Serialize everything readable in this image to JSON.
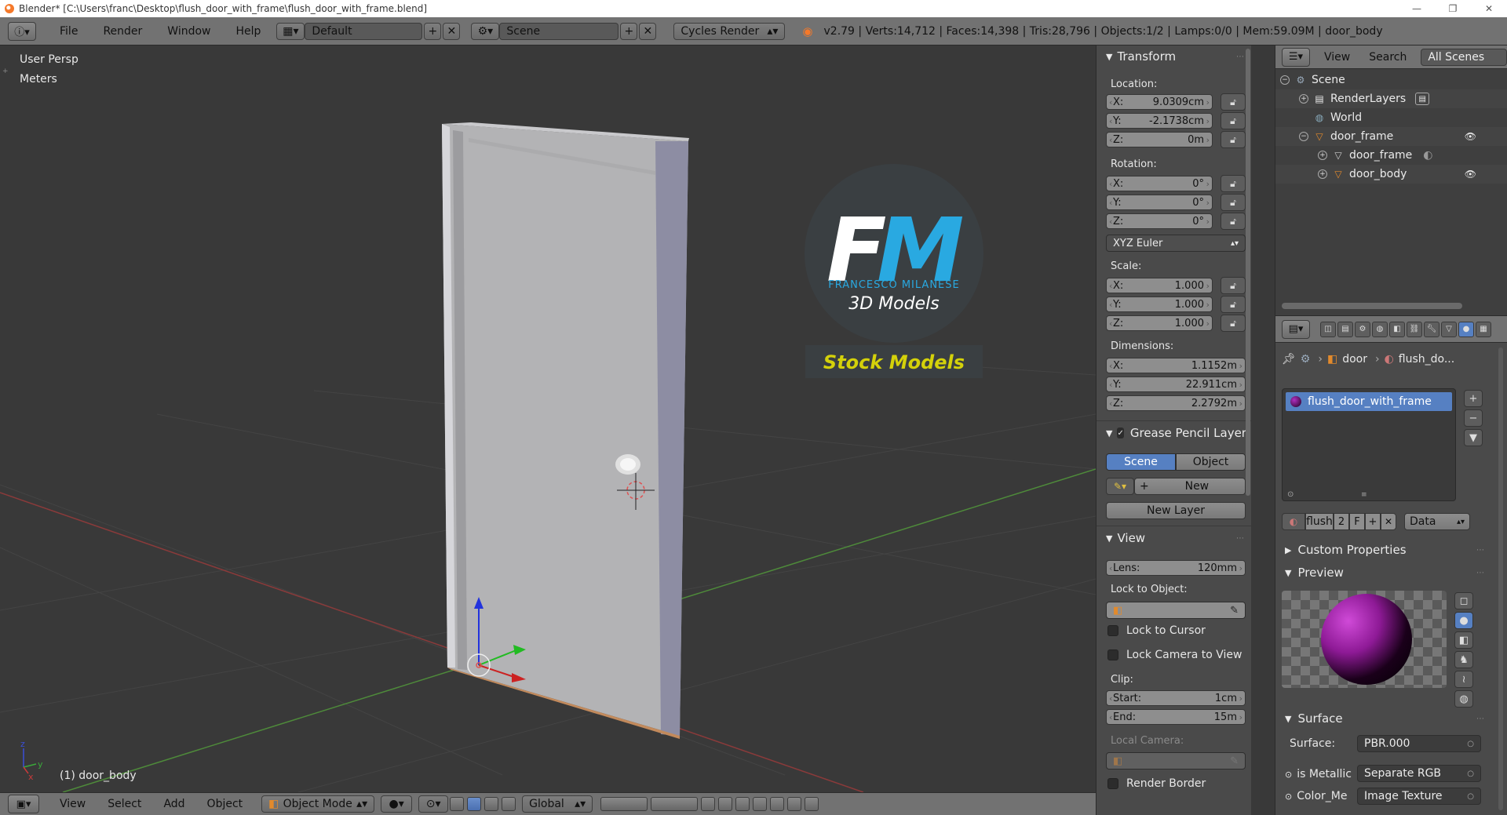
{
  "window": {
    "title": "Blender* [C:\\Users\\franc\\Desktop\\flush_door_with_frame\\flush_door_with_frame.blend]",
    "min": "—",
    "max": "❐",
    "close": "✕"
  },
  "info_header": {
    "menus": [
      "File",
      "Render",
      "Window",
      "Help"
    ],
    "screen_layout": "Default",
    "scene": "Scene",
    "render_engine": "Cycles Render",
    "stats": "v2.79 | Verts:14,712 | Faces:14,398 | Tris:28,796 | Objects:1/2 | Lamps:0/0 | Mem:59.09M | door_body"
  },
  "viewport": {
    "view_name": "User Persp",
    "units": "Meters",
    "active_object": "(1) door_body",
    "watermark": {
      "brand": "FRANCESCO MILANESE",
      "sub": "3D Models",
      "tag": "Stock Models",
      "fm_f": "F",
      "fm_m": "M"
    },
    "axis_x": "x",
    "axis_y": "y",
    "axis_z": "z"
  },
  "viewport_header": {
    "menus": [
      "View",
      "Select",
      "Add",
      "Object"
    ],
    "mode": "Object Mode",
    "orientation": "Global"
  },
  "npanel": {
    "transform": {
      "title": "Transform",
      "location_label": "Location:",
      "location": [
        {
          "k": "X:",
          "v": "9.0309cm"
        },
        {
          "k": "Y:",
          "v": "-2.1738cm"
        },
        {
          "k": "Z:",
          "v": "0m"
        }
      ],
      "rotation_label": "Rotation:",
      "rotation": [
        {
          "k": "X:",
          "v": "0°"
        },
        {
          "k": "Y:",
          "v": "0°"
        },
        {
          "k": "Z:",
          "v": "0°"
        }
      ],
      "rotation_mode": "XYZ Euler",
      "scale_label": "Scale:",
      "scale": [
        {
          "k": "X:",
          "v": "1.000"
        },
        {
          "k": "Y:",
          "v": "1.000"
        },
        {
          "k": "Z:",
          "v": "1.000"
        }
      ],
      "dimensions_label": "Dimensions:",
      "dimensions": [
        {
          "k": "X:",
          "v": "1.1152m"
        },
        {
          "k": "Y:",
          "v": "22.911cm"
        },
        {
          "k": "Z:",
          "v": "2.2792m"
        }
      ]
    },
    "grease_pencil": {
      "title": "Grease Pencil Layer",
      "tab_scene": "Scene",
      "tab_object": "Object",
      "new_btn": "New",
      "new_layer_btn": "New Layer"
    },
    "view": {
      "title": "View",
      "lens_key": "Lens:",
      "lens_val": "120mm",
      "lock_to_object": "Lock to Object:",
      "lock_to_cursor": "Lock to Cursor",
      "lock_camera": "Lock Camera to View",
      "clip_label": "Clip:",
      "clip_start_key": "Start:",
      "clip_start_val": "1cm",
      "clip_end_key": "End:",
      "clip_end_val": "15m",
      "local_camera": "Local Camera:",
      "render_border": "Render Border"
    }
  },
  "outliner": {
    "menus": [
      "View",
      "Search"
    ],
    "filter": "All Scenes",
    "rows": [
      {
        "label": "Scene",
        "indent": 0
      },
      {
        "label": "RenderLayers",
        "indent": 1
      },
      {
        "label": "World",
        "indent": 1
      },
      {
        "label": "door_frame",
        "indent": 1
      },
      {
        "label": "door_frame",
        "indent": 2
      },
      {
        "label": "door_body",
        "indent": 2
      }
    ]
  },
  "properties": {
    "breadcrumb": [
      "door",
      "flush_do..."
    ],
    "material_slot": "flush_door_with_frame",
    "material_name": "flush",
    "material_users": "2",
    "fake_user": "F",
    "link": "Data",
    "custom_properties": "Custom Properties",
    "preview": "Preview",
    "surface_section": "Surface",
    "surface_label": "Surface:",
    "surface_value": "PBR.000",
    "is_metallic_label": "is Metallic",
    "is_metallic_value": "Separate RGB",
    "next_label": "Color_Me",
    "next_value": "Image Texture"
  },
  "colors": {
    "header": "#727272",
    "viewport_bg": "#393939",
    "panel_bg": "#4a4a4a",
    "accent_blue": "#5680c2",
    "fm_blue": "#29a9e1",
    "stock_yellow": "#d4d10a"
  }
}
